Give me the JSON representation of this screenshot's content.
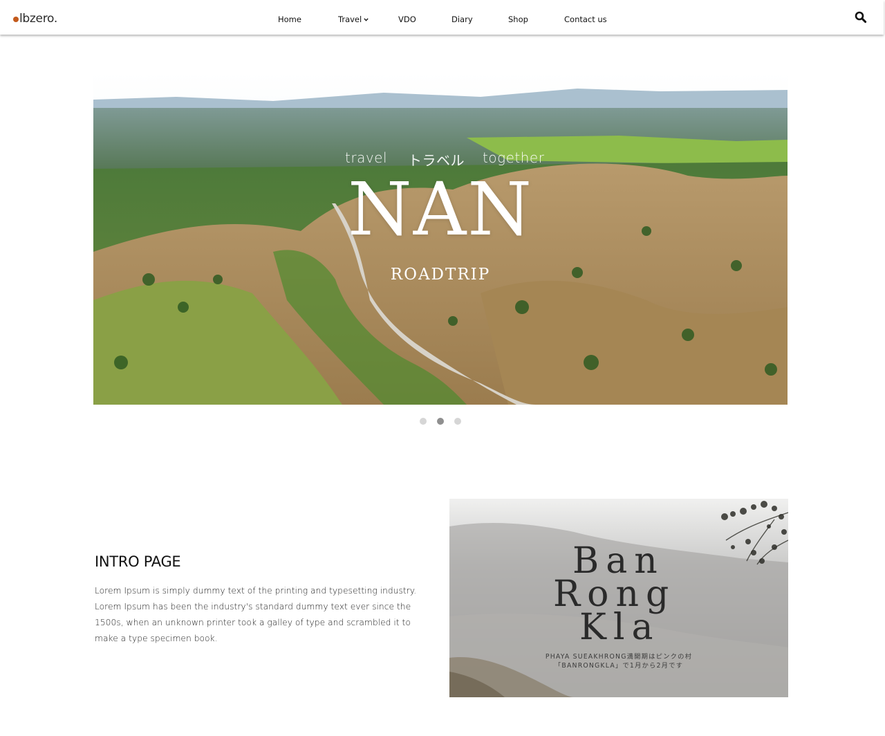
{
  "brand": {
    "logo_text": "lbzero.",
    "logo_dot_color": "#c35a1c"
  },
  "nav": {
    "items": [
      {
        "label": "Home"
      },
      {
        "label": "Travel",
        "has_dropdown": true
      },
      {
        "label": "VDO"
      },
      {
        "label": "Diary"
      },
      {
        "label": "Shop"
      },
      {
        "label": "Contact us"
      }
    ],
    "search_icon": "search-icon"
  },
  "hero": {
    "tag_left": "travel",
    "tag_middle": "トラベル",
    "tag_right": "together",
    "title": "NAN",
    "subtitle": "ROADTRIP"
  },
  "carousel": {
    "slide_count": 3,
    "active_index": 1
  },
  "intro": {
    "title": "INTRO PAGE",
    "body": "Lorem Ipsum is simply dummy text of the printing and typesetting industry. Lorem Ipsum has been the industry's standard dummy text ever since the 1500s, when an unknown printer took a galley of type and scrambled it to make a type specimen book."
  },
  "card": {
    "title_lines": [
      "Ban",
      "Rong",
      "Kla"
    ],
    "subtitle_line1": "PHAYA SUEAKHRONG満開期はピンクの村",
    "subtitle_line2": "「BANRONGKLA」で1月から2月です"
  }
}
